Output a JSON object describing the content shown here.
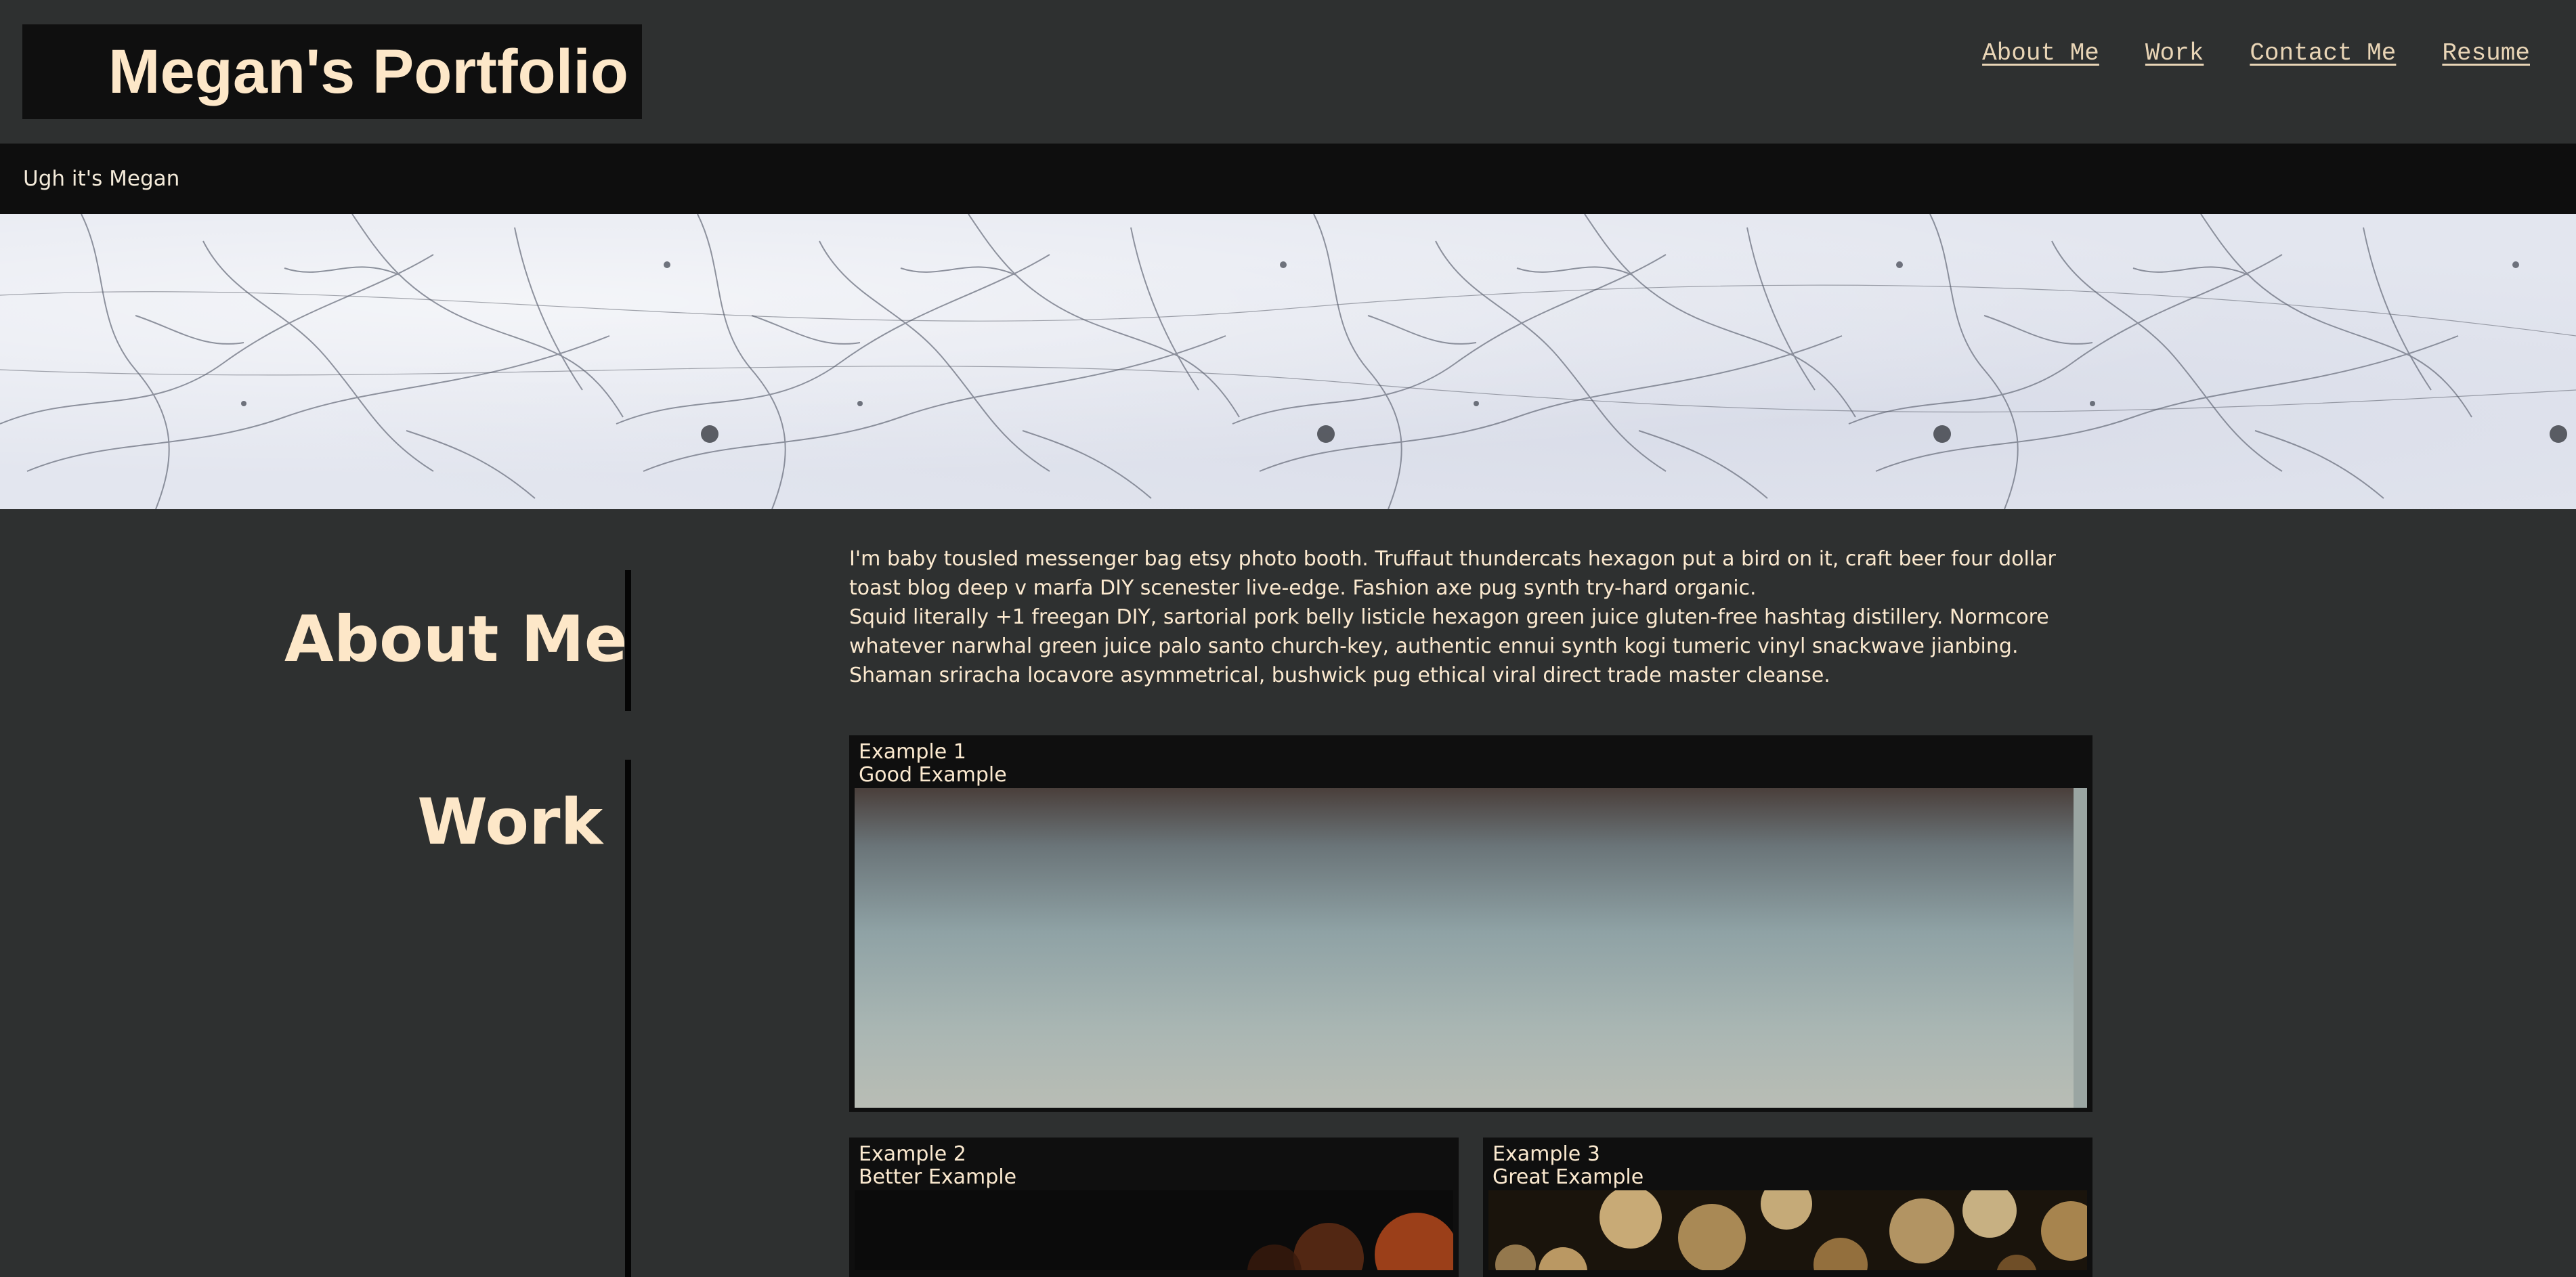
{
  "header": {
    "brand_title": "Megan's Portfolio",
    "nav": [
      {
        "label": "About Me"
      },
      {
        "label": "Work"
      },
      {
        "label": "Contact Me"
      },
      {
        "label": "Resume"
      }
    ]
  },
  "subbar": {
    "tagline": "Ugh it's Megan"
  },
  "sections": {
    "about_title": "About Me",
    "work_title": "Work"
  },
  "about": {
    "paragraph_1": "I'm baby tousled messenger bag etsy photo booth. Truffaut thundercats hexagon put a bird on it, craft beer four dollar toast blog deep v marfa DIY scenester live-edge. Fashion axe pug synth try-hard organic.",
    "paragraph_2": "Squid literally +1 freegan DIY, sartorial pork belly listicle hexagon green juice gluten-free hashtag distillery. Normcore whatever narwhal green juice palo santo church-key, authentic ennui synth kogi tumeric vinyl snackwave jianbing. Shaman sriracha locavore asymmetrical, bushwick pug ethical viral direct trade master cleanse."
  },
  "work": {
    "examples": [
      {
        "title": "Example 1",
        "subtitle": "Good Example"
      },
      {
        "title": "Example 2",
        "subtitle": "Better Example"
      },
      {
        "title": "Example 3",
        "subtitle": "Great Example"
      }
    ]
  },
  "colors": {
    "background": "#2e3030",
    "dark_bar": "#0e0e0e",
    "accent_text": "#fde7c8"
  }
}
